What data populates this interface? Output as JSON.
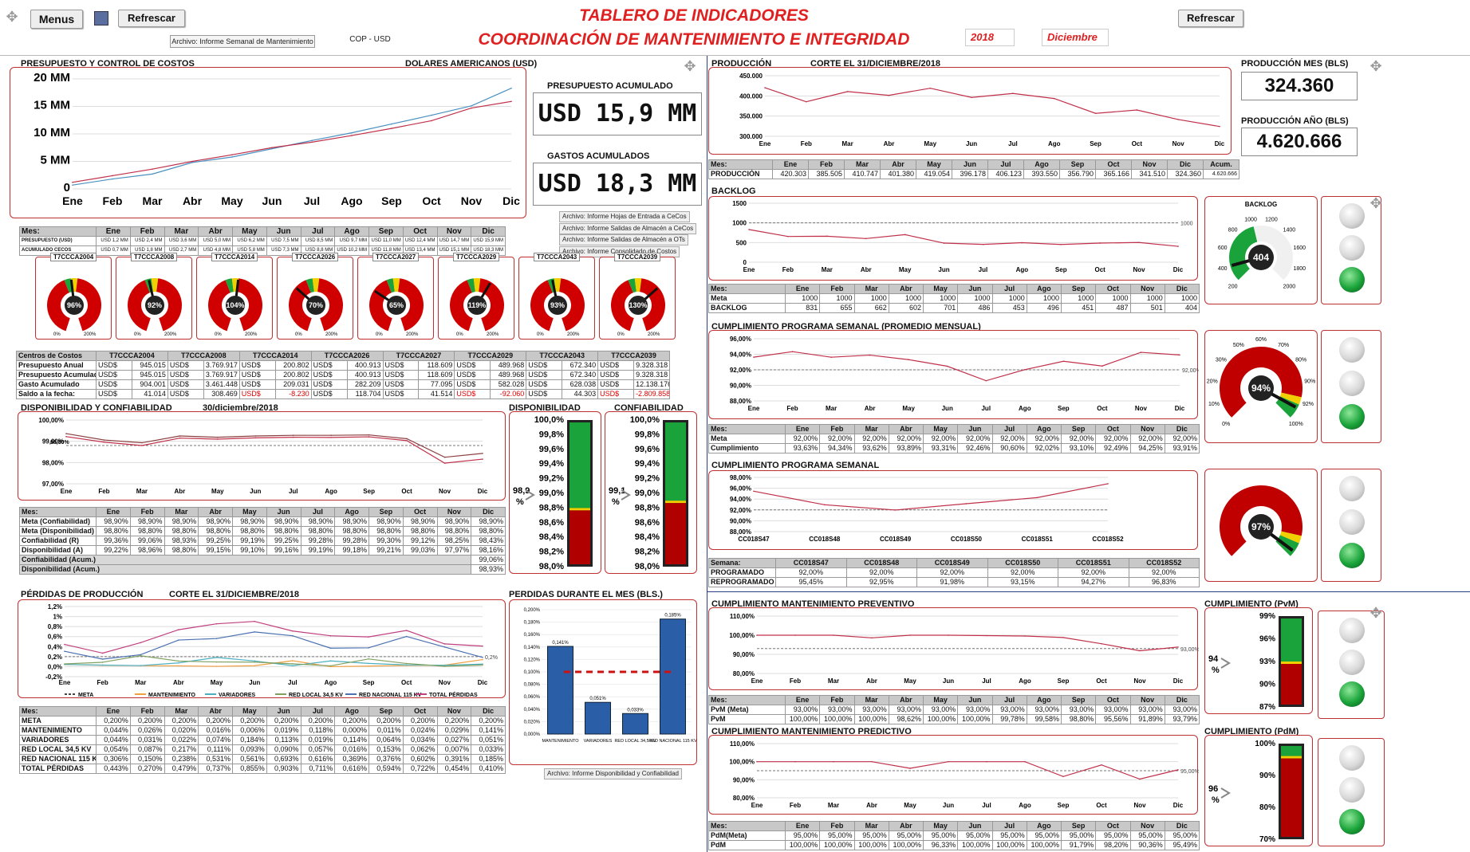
{
  "header": {
    "menus": "Menus",
    "refresh": "Refrescar",
    "refresh_right": "Refrescar",
    "file_link": "Archivo: Informe Semanal de Mantenimiento",
    "currency_btn": "COP - USD",
    "title1": "TABLERO DE INDICADORES",
    "title2": "COORDINACIÓN DE MANTENIMIENTO E INTEGRIDAD",
    "year": "2018",
    "month": "Diciembre"
  },
  "months": [
    "Ene",
    "Feb",
    "Mar",
    "Abr",
    "May",
    "Jun",
    "Jul",
    "Ago",
    "Sep",
    "Oct",
    "Nov",
    "Dic"
  ],
  "colors": {
    "accent": "#e02020",
    "panel_border": "#c03030",
    "line_red": "#c0304a",
    "line_blue": "#4a90c0",
    "bar_blue": "#2a5fa8",
    "green": "#1aa33a"
  },
  "costs": {
    "title": "PRESUPUESTO Y CONTROL DE COSTOS",
    "currency": "DOLARES AMERICANOS (USD)",
    "budget_label": "PRESUPUESTO ACUMULADO",
    "budget_value": "USD 15,9 MM",
    "spend_label": "GASTOS ACUMULADOS",
    "spend_value": "USD 18,3 MM",
    "yticks": [
      "20 MM",
      "15 MM",
      "10 MM",
      "5 MM",
      "0"
    ],
    "links": [
      "Archivo: Informe Hojas de Entrada a CeCos",
      "Archivo: Informe Salidas de Almacén a CeCos",
      "Archivo: Informe Salidas de Almacén a OTs",
      "Archivo: Informe Consolidado de Costos"
    ],
    "table_rows": [
      {
        "label": "PRESUPUESTO (USD)",
        "values": [
          "USD 1,2 MM",
          "USD 2,4 MM",
          "USD 3,6 MM",
          "USD 5,0 MM",
          "USD 6,2 MM",
          "USD 7,5 MM",
          "USD 8,5 MM",
          "USD 9,7 MM",
          "USD 11,0 MM",
          "USD 12,4 MM",
          "USD 14,7 MM",
          "USD 15,9 MM"
        ]
      },
      {
        "label": "ACUMULADO CECOS",
        "values": [
          "USD 0,7 MM",
          "USD 1,8 MM",
          "USD 2,7 MM",
          "USD 4,8 MM",
          "USD 5,8 MM",
          "USD 7,3 MM",
          "USD 8,8 MM",
          "USD 10,2 MM",
          "USD 11,8 MM",
          "USD 13,4 MM",
          "USD 15,1 MM",
          "USD 18,3 MM"
        ]
      }
    ],
    "gauges": [
      {
        "name": "T7CCCA2004",
        "value": "96%"
      },
      {
        "name": "T7CCCA2008",
        "value": "92%"
      },
      {
        "name": "T7CCCA2014",
        "value": "104%"
      },
      {
        "name": "T7CCCA2026",
        "value": "70%"
      },
      {
        "name": "T7CCCA2027",
        "value": "65%"
      },
      {
        "name": "T7CCCA2029",
        "value": "119%"
      },
      {
        "name": "T7CCCA2043",
        "value": "93%"
      },
      {
        "name": "T7CCCA2039",
        "value": "130%"
      }
    ],
    "gauge_scale": [
      "0%",
      "20%",
      "40%",
      "60%",
      "80%",
      "100%",
      "120%",
      "140%",
      "160%",
      "180%",
      "200%"
    ],
    "centers_header": "Centros de Costos",
    "centers": [
      {
        "label": "Presupuesto Anual",
        "values": [
          "945.015",
          "3.769.917",
          "200.802",
          "400.913",
          "118.609",
          "489.968",
          "672.340",
          "9.328.318"
        ]
      },
      {
        "label": "Presupuesto Acumulado",
        "values": [
          "945.015",
          "3.769.917",
          "200.802",
          "400.913",
          "118.609",
          "489.968",
          "672.340",
          "9.328.318"
        ]
      },
      {
        "label": "Gasto Acumulado",
        "values": [
          "904.001",
          "3.461.448",
          "209.031",
          "282.209",
          "77.095",
          "582.028",
          "628.038",
          "12.138.176"
        ]
      },
      {
        "label": "Saldo a la fecha:",
        "values": [
          "41.014",
          "308.469",
          "-8.230",
          "118.704",
          "41.514",
          "-92.060",
          "44.303",
          "-2.809.858"
        ]
      }
    ]
  },
  "production": {
    "title": "PRODUCCIÓN",
    "cut": "CORTE EL 31/DICIEMBRE/2018",
    "month_label": "PRODUCCIÓN MES (BLS)",
    "month_value": "324.360",
    "year_label": "PRODUCCIÓN AÑO (BLS)",
    "year_value": "4.620.666",
    "yticks": [
      "450.000",
      "400.000",
      "350.000",
      "300.000"
    ],
    "row_label": "PRODUCCIÓN",
    "acum_label": "Acum.",
    "values": [
      420.303,
      385.505,
      410.747,
      401.38,
      419.054,
      396.178,
      406.123,
      393.55,
      356.79,
      365.166,
      341.51,
      324.36
    ],
    "display": [
      "420.303",
      "385.505",
      "410.747",
      "401.380",
      "419.054",
      "396.178",
      "406.123",
      "393.550",
      "356.790",
      "365.166",
      "341.510",
      "324.360"
    ],
    "acum": "4.620.666"
  },
  "backlog": {
    "title": "BACKLOG",
    "yticks": [
      "1500",
      "1000",
      "500",
      "0"
    ],
    "meta_label": "Meta",
    "row_label": "BACKLOG",
    "meta": [
      "1000",
      "1000",
      "1000",
      "1000",
      "1000",
      "1000",
      "1000",
      "1000",
      "1000",
      "1000",
      "1000",
      "1000"
    ],
    "values": [
      831,
      655,
      662,
      602,
      701,
      486,
      453,
      496,
      451,
      487,
      501,
      404
    ],
    "gauge_title": "BACKLOG",
    "gauge_value": "404",
    "gauge_ticks": [
      "200",
      "400",
      "600",
      "800",
      "1000",
      "1200",
      "1400",
      "1600",
      "1800",
      "2000"
    ],
    "meta_marker": "1000"
  },
  "cps_mensual": {
    "title": "CUMPLIMIENTO PROGRAMA SEMANAL (PROMEDIO MENSUAL)",
    "yticks": [
      "96,00%",
      "94,00%",
      "92,00%",
      "90,00%",
      "88,00%"
    ],
    "meta_label": "Meta",
    "row_label": "Cumplimiento",
    "meta": [
      "92,00%",
      "92,00%",
      "92,00%",
      "92,00%",
      "92,00%",
      "92,00%",
      "92,00%",
      "92,00%",
      "92,00%",
      "92,00%",
      "92,00%",
      "92,00%"
    ],
    "values": [
      93.63,
      94.34,
      93.62,
      93.89,
      93.31,
      92.46,
      90.6,
      92.02,
      93.1,
      92.49,
      94.25,
      93.91
    ],
    "display": [
      "93,63%",
      "94,34%",
      "93,62%",
      "93,89%",
      "93,31%",
      "92,46%",
      "90,60%",
      "92,02%",
      "93,10%",
      "92,49%",
      "94,25%",
      "93,91%"
    ],
    "meta_marker": "92,00%",
    "gauge_value": "94%",
    "gauge_ticks": [
      "0%",
      "10%",
      "20%",
      "30%",
      "50%",
      "60%",
      "70%",
      "80%",
      "90%",
      "92%",
      "100%"
    ]
  },
  "cps_semanal": {
    "title": "CUMPLIMIENTO PROGRAMA SEMANAL",
    "yticks": [
      "98,00%",
      "96,00%",
      "94,00%",
      "92,00%",
      "90,00%",
      "88,00%"
    ],
    "week_label": "Semana:",
    "weeks": [
      "CC018S47",
      "CC018S48",
      "CC018S49",
      "CC018S50",
      "CC018S51",
      "CC018S52"
    ],
    "prog_label": "PROGRAMADO",
    "reprog_label": "REPROGRAMADO",
    "prog": [
      "92,00%",
      "92,00%",
      "92,00%",
      "92,00%",
      "92,00%",
      "92,00%"
    ],
    "reprog_values": [
      95.45,
      92.95,
      91.98,
      93.15,
      94.27,
      96.83
    ],
    "reprog": [
      "95,45%",
      "92,95%",
      "91,98%",
      "93,15%",
      "94,27%",
      "96,83%"
    ],
    "gauge_value": "97%"
  },
  "pvm": {
    "title": "CUMPLIMIENTO MANTENIMIENTO PREVENTIVO",
    "yticks": [
      "110,00%",
      "100,00%",
      "90,00%",
      "80,00%"
    ],
    "meta_label": "PvM (Meta)",
    "row_label": "PvM",
    "meta": [
      "93,00%",
      "93,00%",
      "93,00%",
      "93,00%",
      "93,00%",
      "93,00%",
      "93,00%",
      "93,00%",
      "93,00%",
      "93,00%",
      "93,00%",
      "93,00%"
    ],
    "values": [
      100,
      100,
      100,
      98.62,
      100,
      100,
      99.78,
      99.58,
      98.8,
      95.56,
      91.89,
      93.79
    ],
    "display": [
      "100,00%",
      "100,00%",
      "100,00%",
      "98,62%",
      "100,00%",
      "100,00%",
      "99,78%",
      "99,58%",
      "98,80%",
      "95,56%",
      "91,89%",
      "93,79%"
    ],
    "meta_marker": "93,00%",
    "therm_title": "CUMPLIMIENTO (PvM)",
    "therm_value": "94",
    "therm_unit": "%",
    "therm_ticks": [
      "99%",
      "96%",
      "93%",
      "90%",
      "87%"
    ]
  },
  "pdm": {
    "title": "CUMPLIMIENTO MANTENIMIENTO PREDICTIVO",
    "yticks": [
      "110,00%",
      "100,00%",
      "90,00%",
      "80,00%"
    ],
    "meta_label": "PdM(Meta)",
    "row_label": "PdM",
    "meta": [
      "95,00%",
      "95,00%",
      "95,00%",
      "95,00%",
      "95,00%",
      "95,00%",
      "95,00%",
      "95,00%",
      "95,00%",
      "95,00%",
      "95,00%",
      "95,00%"
    ],
    "values": [
      100,
      100,
      100,
      100,
      96.33,
      100,
      100,
      100,
      91.79,
      98.2,
      90.36,
      95.49
    ],
    "display": [
      "100,00%",
      "100,00%",
      "100,00%",
      "100,00%",
      "96,33%",
      "100,00%",
      "100,00%",
      "100,00%",
      "91,79%",
      "98,20%",
      "90,36%",
      "95,49%"
    ],
    "meta_marker": "95,00%",
    "therm_title": "CUMPLIMIENTO (PdM)",
    "therm_value": "96",
    "therm_unit": "%",
    "therm_ticks": [
      "100%",
      "90%",
      "80%",
      "70%"
    ]
  },
  "availability": {
    "title": "DISPONIBILIDAD Y CONFIABILIDAD",
    "date": "30/diciembre/2018",
    "yticks": [
      "100,00%",
      "99,00%",
      "98,00%",
      "97,00%"
    ],
    "marker": "98,80%",
    "rows": [
      {
        "label": "Meta (Confiabilidad)",
        "values": [
          "98,90%",
          "98,90%",
          "98,90%",
          "98,90%",
          "98,90%",
          "98,90%",
          "98,90%",
          "98,90%",
          "98,90%",
          "98,90%",
          "98,90%",
          "98,90%"
        ]
      },
      {
        "label": "Meta (Disponibilidad)",
        "values": [
          "98,80%",
          "98,80%",
          "98,80%",
          "98,80%",
          "98,80%",
          "98,80%",
          "98,80%",
          "98,80%",
          "98,80%",
          "98,80%",
          "98,80%",
          "98,80%"
        ]
      },
      {
        "label": "Confiabilidad (R)",
        "values": [
          "99,36%",
          "99,06%",
          "98,93%",
          "99,25%",
          "99,19%",
          "99,25%",
          "99,28%",
          "99,28%",
          "99,30%",
          "99,12%",
          "98,25%",
          "98,43%"
        ]
      },
      {
        "label": "Disponibilidad (A)",
        "values": [
          "99,22%",
          "98,96%",
          "98,80%",
          "99,15%",
          "99,10%",
          "99,16%",
          "99,19%",
          "99,18%",
          "99,21%",
          "99,03%",
          "97,97%",
          "98,16%"
        ]
      }
    ],
    "conf_acum_label": "Confiabilidad (Acum.)",
    "conf_acum": "99,06%",
    "disp_acum_label": "Disponibilidad (Acum.)",
    "disp_acum": "98,93%",
    "disp_title": "DISPONIBILIDAD",
    "conf_title": "CONFIABILIDAD",
    "therm_ticks": [
      "100,0%",
      "99,8%",
      "99,6%",
      "99,4%",
      "99,2%",
      "99,0%",
      "98,8%",
      "98,6%",
      "98,4%",
      "98,2%",
      "98,0%"
    ],
    "disp_value": "98,9",
    "conf_value": "99,1",
    "unit": "%",
    "conf_series": [
      99.36,
      99.06,
      98.93,
      99.25,
      99.19,
      99.25,
      99.28,
      99.28,
      99.3,
      99.12,
      98.25,
      98.43
    ],
    "disp_series": [
      99.22,
      98.96,
      98.8,
      99.15,
      99.1,
      99.16,
      99.19,
      99.18,
      99.21,
      99.03,
      97.97,
      98.16
    ]
  },
  "losses": {
    "title": "PÉRDIDAS DE PRODUCCIÓN",
    "cut": "CORTE EL 31/DICIEMBRE/2018",
    "yticks": [
      "1,2%",
      "1%",
      "0,8%",
      "0,6%",
      "0,4%",
      "0,2%",
      "0,0%",
      "-0,2%"
    ],
    "marker": "0,2%",
    "legend": [
      "META",
      "MANTENIMIENTO",
      "VARIADORES",
      "RED LOCAL 34,5 KV",
      "RED NACIONAL 115 KV",
      "TOTAL PÉRDIDAS"
    ],
    "rows": [
      {
        "label": "META",
        "values": [
          "0,200%",
          "0,200%",
          "0,200%",
          "0,200%",
          "0,200%",
          "0,200%",
          "0,200%",
          "0,200%",
          "0,200%",
          "0,200%",
          "0,200%",
          "0,200%"
        ]
      },
      {
        "label": "MANTENIMIENTO",
        "values": [
          "0,044%",
          "0,026%",
          "0,020%",
          "0,016%",
          "0,006%",
          "0,019%",
          "0,118%",
          "0,000%",
          "0,011%",
          "0,024%",
          "0,029%",
          "0,141%"
        ]
      },
      {
        "label": "VARIADORES",
        "values": [
          "0,044%",
          "0,031%",
          "0,022%",
          "0,074%",
          "0,184%",
          "0,113%",
          "0,019%",
          "0,114%",
          "0,064%",
          "0,034%",
          "0,027%",
          "0,051%"
        ]
      },
      {
        "label": "RED LOCAL 34,5 KV",
        "values": [
          "0,054%",
          "0,087%",
          "0,217%",
          "0,111%",
          "0,093%",
          "0,090%",
          "0,057%",
          "0,016%",
          "0,153%",
          "0,062%",
          "0,007%",
          "0,033%"
        ]
      },
      {
        "label": "RED NACIONAL 115 KV",
        "values": [
          "0,306%",
          "0,150%",
          "0,238%",
          "0,531%",
          "0,561%",
          "0,693%",
          "0,616%",
          "0,369%",
          "0,376%",
          "0,602%",
          "0,391%",
          "0,185%"
        ]
      },
      {
        "label": "TOTAL PÉRDIDAS",
        "values": [
          "0,443%",
          "0,270%",
          "0,479%",
          "0,737%",
          "0,855%",
          "0,903%",
          "0,711%",
          "0,616%",
          "0,594%",
          "0,722%",
          "0,454%",
          "0,410%"
        ]
      }
    ],
    "series": [
      {
        "name": "MANTENIMIENTO",
        "values": [
          0.044,
          0.026,
          0.02,
          0.016,
          0.006,
          0.019,
          0.118,
          0.0,
          0.011,
          0.024,
          0.029,
          0.141
        ]
      },
      {
        "name": "VARIADORES",
        "values": [
          0.044,
          0.031,
          0.022,
          0.074,
          0.184,
          0.113,
          0.019,
          0.114,
          0.064,
          0.034,
          0.027,
          0.051
        ]
      },
      {
        "name": "RED LOCAL 34,5 KV",
        "values": [
          0.054,
          0.087,
          0.217,
          0.111,
          0.093,
          0.09,
          0.057,
          0.016,
          0.153,
          0.062,
          0.007,
          0.033
        ]
      },
      {
        "name": "RED NACIONAL 115 KV",
        "values": [
          0.306,
          0.15,
          0.238,
          0.531,
          0.561,
          0.693,
          0.616,
          0.369,
          0.376,
          0.602,
          0.391,
          0.185
        ]
      },
      {
        "name": "TOTAL PÉRDIDAS",
        "values": [
          0.443,
          0.27,
          0.479,
          0.737,
          0.855,
          0.903,
          0.711,
          0.616,
          0.594,
          0.722,
          0.454,
          0.41
        ]
      }
    ],
    "month_title": "PERDIDAS DURANTE EL MES (BLS.)",
    "bar_yticks": [
      "0,200%",
      "0,180%",
      "0,160%",
      "0,140%",
      "0,120%",
      "0,100%",
      "0,080%",
      "0,060%",
      "0,040%",
      "0,020%",
      "0,000%"
    ],
    "bars": [
      {
        "label": "MANTENIMIENTO",
        "value": 0.141,
        "text": "0,141%"
      },
      {
        "label": "VARIADORES",
        "value": 0.051,
        "text": "0,051%"
      },
      {
        "label": "RED LOCAL 34,5 KV",
        "value": 0.033,
        "text": "0,033%"
      },
      {
        "label": "RED NACIONAL 115 KV",
        "value": 0.185,
        "text": "0,185%"
      }
    ],
    "bar_meta": 0.1,
    "file_link": "Archivo: Informe Disponibilidad y Confiabilidad"
  }
}
